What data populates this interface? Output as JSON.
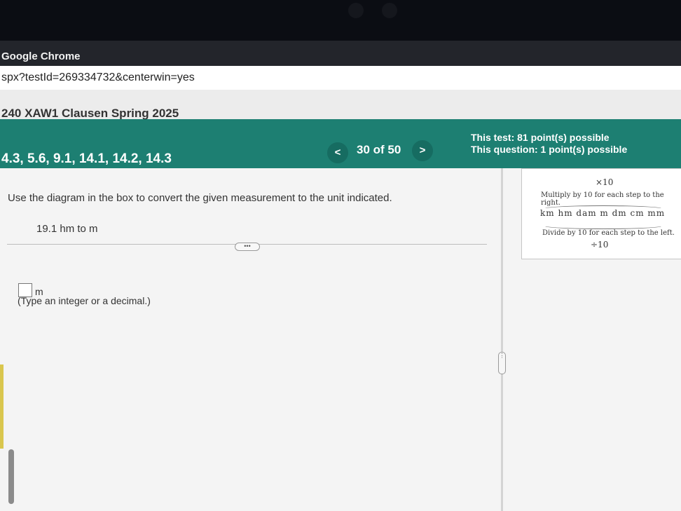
{
  "browser": {
    "app_name": "Google Chrome",
    "url": "spx?testId=269334732&centerwin=yes",
    "course_title": "240 XAW1 Clausen Spring 2025"
  },
  "header": {
    "sections": "4.3, 5.6, 9.1, 14.1, 14.2, 14.3",
    "prev_label": "<",
    "next_label": ">",
    "counter": "30 of 50",
    "test_points": "This test: 81 point(s) possible",
    "question_points": "This question: 1 point(s) possible"
  },
  "question": {
    "instruction": "Use the diagram in the box to convert the given measurement to the unit indicated.",
    "problem": "19.1 hm to m",
    "more_label": "•••",
    "answer_value": "",
    "answer_unit": "m",
    "hint": "(Type an integer or a decimal.)"
  },
  "diagram": {
    "times_label": "×10",
    "multiply_rule": "Multiply by 10 for each step to the right.",
    "units": "km hm dam m dm cm mm",
    "divide_rule": "Divide by 10 for each step to the left.",
    "divide_label": "÷10"
  },
  "colors": {
    "banner": "#1d7f72",
    "nav_button": "#166c61"
  }
}
